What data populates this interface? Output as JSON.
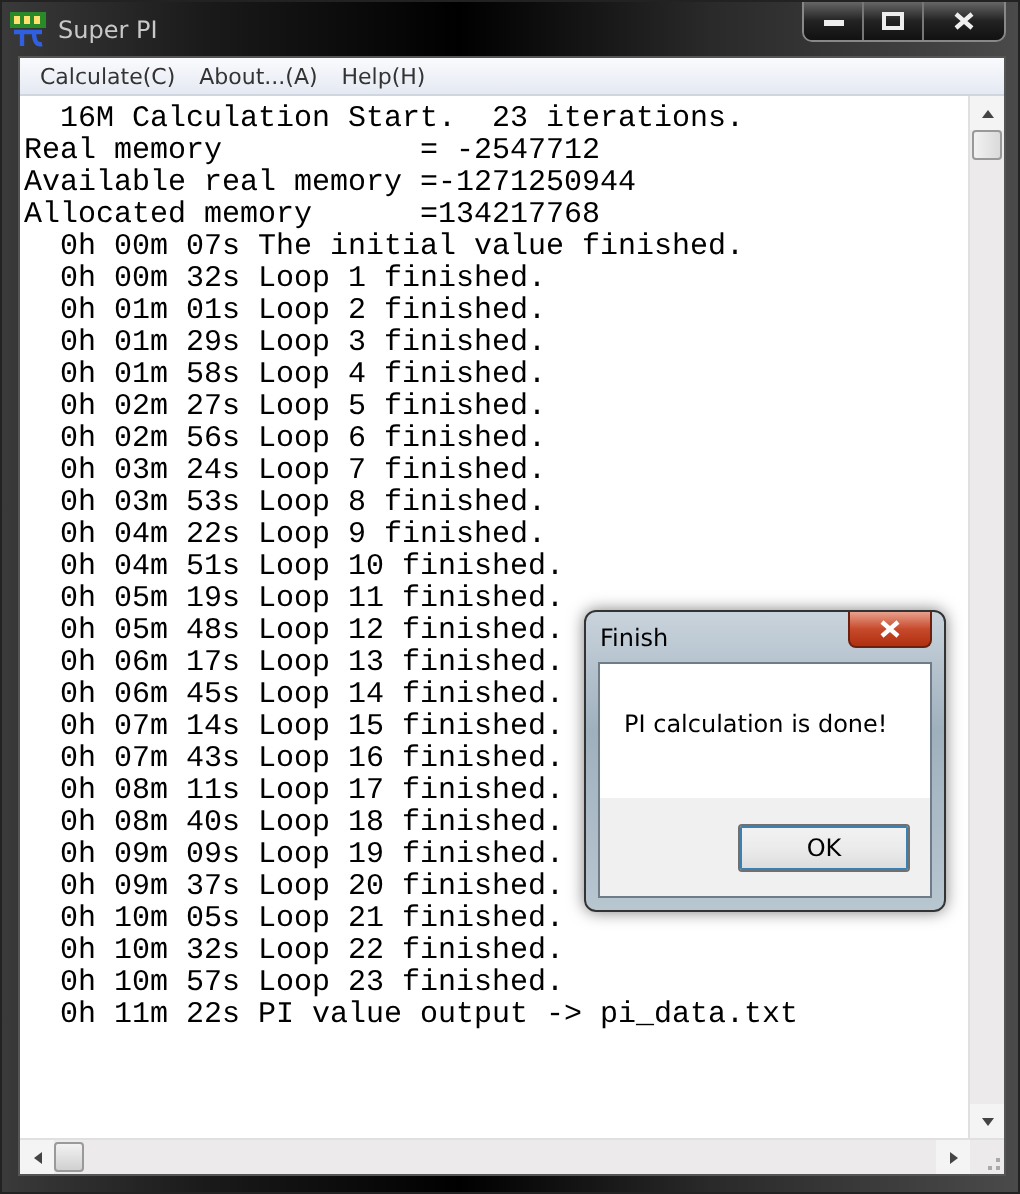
{
  "window": {
    "title": "Super PI"
  },
  "menu": [
    "Calculate(C)",
    "About...(A)",
    "Help(H)"
  ],
  "console": {
    "lines": [
      "  16M Calculation Start.  23 iterations.",
      "Real memory           = -2547712",
      "Available real memory =-1271250944",
      "Allocated memory      =134217768",
      "  0h 00m 07s The initial value finished.",
      "  0h 00m 32s Loop 1 finished.",
      "  0h 01m 01s Loop 2 finished.",
      "  0h 01m 29s Loop 3 finished.",
      "  0h 01m 58s Loop 4 finished.",
      "  0h 02m 27s Loop 5 finished.",
      "  0h 02m 56s Loop 6 finished.",
      "  0h 03m 24s Loop 7 finished.",
      "  0h 03m 53s Loop 8 finished.",
      "  0h 04m 22s Loop 9 finished.",
      "  0h 04m 51s Loop 10 finished.",
      "  0h 05m 19s Loop 11 finished.",
      "  0h 05m 48s Loop 12 finished.",
      "  0h 06m 17s Loop 13 finished.",
      "  0h 06m 45s Loop 14 finished.",
      "  0h 07m 14s Loop 15 finished.",
      "  0h 07m 43s Loop 16 finished.",
      "  0h 08m 11s Loop 17 finished.",
      "  0h 08m 40s Loop 18 finished.",
      "  0h 09m 09s Loop 19 finished.",
      "  0h 09m 37s Loop 20 finished.",
      "  0h 10m 05s Loop 21 finished.",
      "  0h 10m 32s Loop 22 finished.",
      "  0h 10m 57s Loop 23 finished.",
      "  0h 11m 22s PI value output -> pi_data.txt"
    ]
  },
  "dialog": {
    "title": "Finish",
    "message": "PI calculation is done!",
    "button": "OK"
  }
}
